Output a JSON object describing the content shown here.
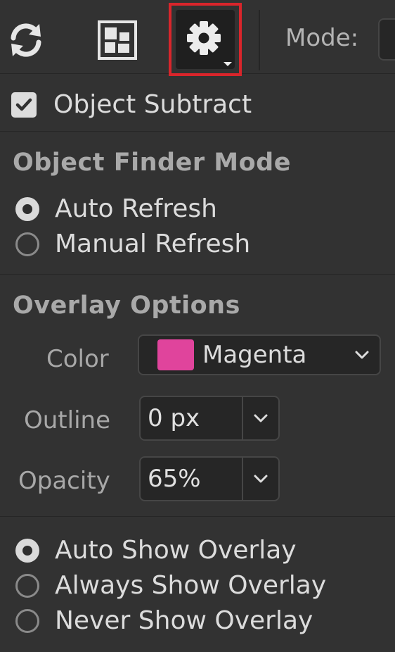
{
  "toolbar": {
    "refresh_icon": "refresh-icon",
    "layout_icon": "layout-grid-icon",
    "settings_icon": "gear-icon",
    "mode_label": "Mode:"
  },
  "object_subtract": {
    "label": "Object Subtract",
    "checked": true
  },
  "finder_mode": {
    "title": "Object Finder Mode",
    "options": [
      {
        "label": "Auto Refresh",
        "selected": true
      },
      {
        "label": "Manual Refresh",
        "selected": false
      }
    ]
  },
  "overlay": {
    "title": "Overlay Options",
    "color_label": "Color",
    "color_value": "Magenta",
    "color_hex": "#e0449c",
    "outline_label": "Outline",
    "outline_value": "0 px",
    "opacity_label": "Opacity",
    "opacity_value": "65%"
  },
  "overlay_visibility": {
    "options": [
      {
        "label": "Auto Show Overlay",
        "selected": true
      },
      {
        "label": "Always Show Overlay",
        "selected": false
      },
      {
        "label": "Never Show Overlay",
        "selected": false
      }
    ]
  },
  "colors": {
    "highlight": "#d9252b",
    "panel_bg": "#323232"
  }
}
